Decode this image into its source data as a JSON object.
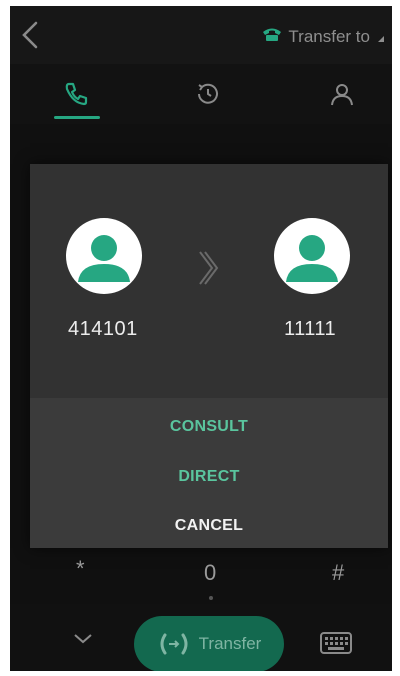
{
  "header": {
    "transfer_label": "Transfer to"
  },
  "tabs": [
    {
      "name": "dial",
      "icon": "phone-icon",
      "active": true
    },
    {
      "name": "history",
      "icon": "history-icon",
      "active": false
    },
    {
      "name": "contacts",
      "icon": "contacts-icon",
      "active": false
    }
  ],
  "dialog": {
    "from_number": "414101",
    "to_number": "11111",
    "options": {
      "consult": "CONSULT",
      "direct": "DIRECT",
      "cancel": "CANCEL"
    }
  },
  "keypad": {
    "star": "*",
    "zero": "0",
    "hash": "#"
  },
  "bottom": {
    "transfer_button": "Transfer"
  },
  "colors": {
    "accent": "#26a782",
    "option_text": "#5ac59e",
    "button_bg": "#13694f",
    "screen_bg": "#101010",
    "dialog_bg": "#323232"
  }
}
